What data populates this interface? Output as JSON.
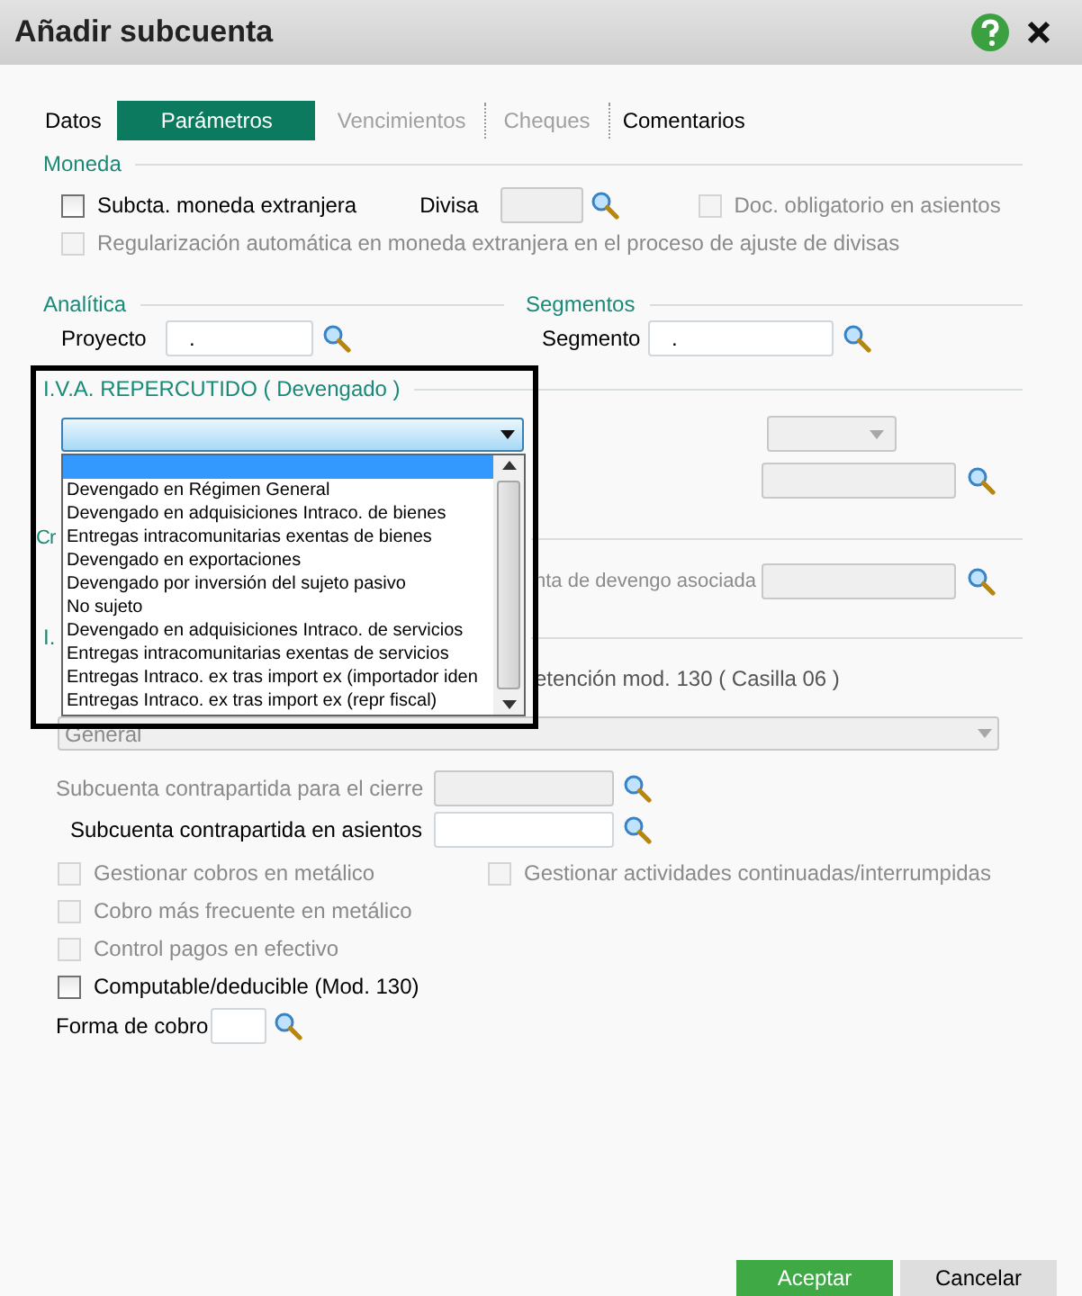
{
  "window": {
    "title": "Añadir subcuenta"
  },
  "tabs": [
    {
      "label": "Datos",
      "selected": false,
      "disabled": false
    },
    {
      "label": "Parámetros",
      "selected": true,
      "disabled": false
    },
    {
      "label": "Vencimientos",
      "selected": false,
      "disabled": true
    },
    {
      "label": "Cheques",
      "selected": false,
      "disabled": true
    },
    {
      "label": "Comentarios",
      "selected": false,
      "disabled": false
    }
  ],
  "moneda": {
    "heading": "Moneda",
    "foreign_currency": {
      "label": "Subcta. moneda extranjera",
      "checked": false,
      "disabled": false
    },
    "divisa": {
      "label": "Divisa",
      "disabled": true
    },
    "doc_required": {
      "label": "Doc. obligatorio en asientos",
      "checked": false,
      "disabled": true
    },
    "auto_regularization": {
      "label": "Regularización automática en moneda extranjera en el proceso de ajuste de divisas",
      "checked": false,
      "disabled": true
    }
  },
  "analitica": {
    "heading": "Analítica",
    "proyecto": {
      "label": "Proyecto",
      "value": "."
    }
  },
  "segmentos": {
    "heading": "Segmentos",
    "segmento": {
      "label": "Segmento",
      "value": "."
    }
  },
  "iva": {
    "heading": "I.V.A. REPERCUTIDO ( Devengado )",
    "dropdown": {
      "expanded": true,
      "empty_option_selected": true,
      "options": [
        "Devengado en Régimen General",
        "Devengado en adquisiciones Intraco. de bienes",
        "Entregas intracomunitarias exentas de bienes",
        "Devengado en exportaciones",
        "Devengado por inversión del sujeto pasivo",
        "No sujeto",
        "Devengado en adquisiciones Intraco. de servicios",
        "Entregas intracomunitarias exentas de servicios",
        "Entregas Intraco. ex tras import ex (importador iden",
        "Entregas Intraco. ex tras import ex (repr fiscal)"
      ]
    }
  },
  "section_3": {
    "heading": "Cr",
    "field_label": "nta de devengo asociada"
  },
  "section_4": {
    "heading": "I.",
    "field_label": "etención mod. 130 ( Casilla 06 )",
    "combo": {
      "value": "General",
      "disabled": true
    }
  },
  "cierre": {
    "label": "Subcuenta contrapartida para el cierre",
    "disabled": true
  },
  "asientos": {
    "label": "Subcuenta contrapartida en asientos",
    "disabled": false
  },
  "options": [
    {
      "label": "Gestionar cobros en metálico",
      "checked": false,
      "disabled": true
    },
    {
      "label": "Cobro más frecuente en metálico",
      "checked": false,
      "disabled": true
    },
    {
      "label": "Control pagos en efectivo",
      "checked": false,
      "disabled": true
    },
    {
      "label": "Computable/deducible (Mod. 130)",
      "checked": false,
      "disabled": false
    }
  ],
  "activities": {
    "label": "Gestionar actividades continuadas/interrumpidas",
    "checked": false,
    "disabled": true
  },
  "forma_cobro": {
    "label": "Forma de cobro"
  },
  "buttons": [
    {
      "label": "Aceptar",
      "kind": "primary"
    },
    {
      "label": "Cancelar",
      "kind": "secondary"
    }
  ]
}
